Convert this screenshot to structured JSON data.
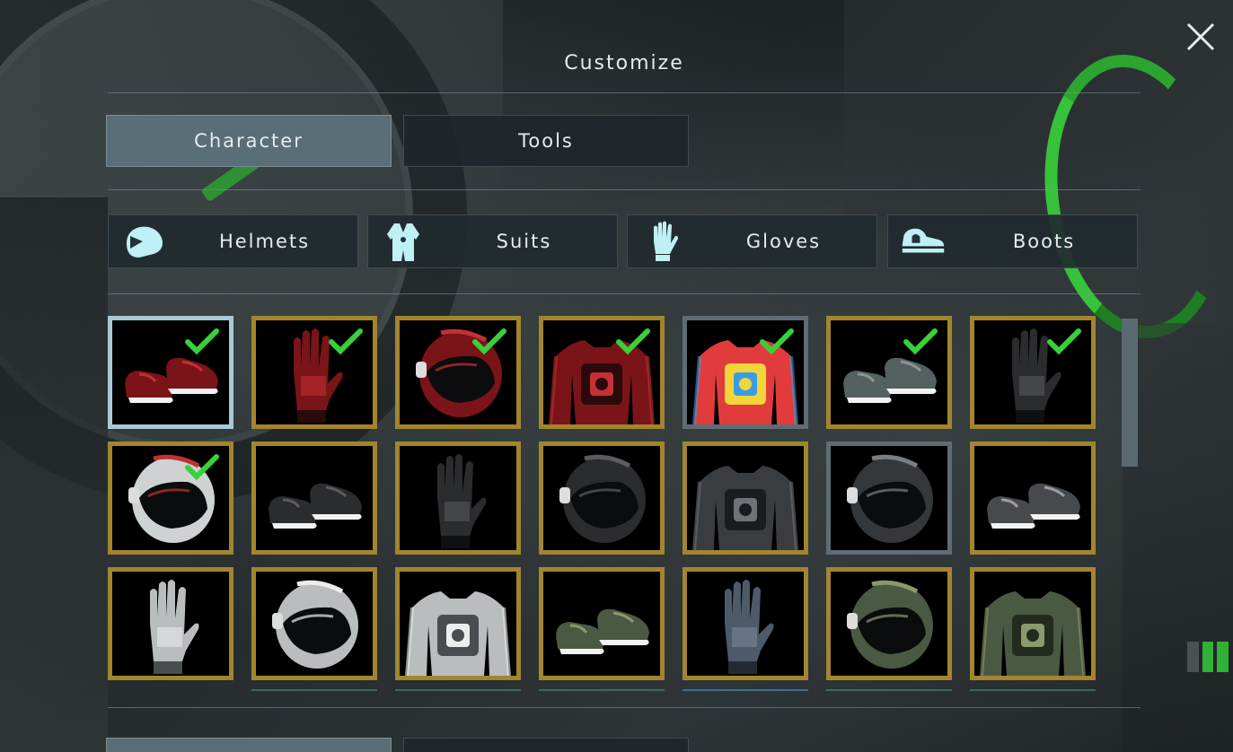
{
  "window": {
    "title": "Customize"
  },
  "tabs": [
    {
      "label": "Character",
      "active": true
    },
    {
      "label": "Tools",
      "active": false
    }
  ],
  "categories": [
    {
      "label": "Helmets",
      "icon": "helmet-icon"
    },
    {
      "label": "Suits",
      "icon": "suit-icon"
    },
    {
      "label": "Gloves",
      "icon": "glove-icon"
    },
    {
      "label": "Boots",
      "icon": "boot-icon"
    }
  ],
  "colors": {
    "accent_active_tab": "#5a6e77",
    "item_border_gold": "#a3852f",
    "item_border_selected": "#a9c9d8",
    "item_border_grey": "#5f6c73",
    "check_green": "#37d13a",
    "icon_cyan": "#bff0f5"
  },
  "items": [
    {
      "type": "boots",
      "variant": "red",
      "equipped": true,
      "selected": true
    },
    {
      "type": "gloves",
      "variant": "red",
      "equipped": true
    },
    {
      "type": "helmet",
      "variant": "red",
      "equipped": true
    },
    {
      "type": "suit",
      "variant": "red",
      "equipped": true
    },
    {
      "type": "suit",
      "variant": "rainbow",
      "equipped": true,
      "frame": "grey"
    },
    {
      "type": "boots",
      "variant": "camo-grey",
      "equipped": true
    },
    {
      "type": "gloves",
      "variant": "black",
      "equipped": true
    },
    {
      "type": "helmet",
      "variant": "white-red",
      "equipped": true
    },
    {
      "type": "boots",
      "variant": "black",
      "equipped": false
    },
    {
      "type": "gloves",
      "variant": "black",
      "equipped": false
    },
    {
      "type": "helmet",
      "variant": "black",
      "equipped": false
    },
    {
      "type": "suit",
      "variant": "dark-grey",
      "equipped": false
    },
    {
      "type": "helmet",
      "variant": "dark-metal",
      "equipped": false,
      "frame": "grey"
    },
    {
      "type": "boots",
      "variant": "grey",
      "equipped": false
    },
    {
      "type": "gloves",
      "variant": "white",
      "equipped": false
    },
    {
      "type": "helmet",
      "variant": "white",
      "equipped": false
    },
    {
      "type": "suit",
      "variant": "white",
      "equipped": false
    },
    {
      "type": "boots",
      "variant": "camo-green",
      "equipped": false
    },
    {
      "type": "gloves",
      "variant": "blue-grey",
      "equipped": false
    },
    {
      "type": "helmet",
      "variant": "camo-green",
      "equipped": false
    },
    {
      "type": "suit",
      "variant": "camo-green",
      "equipped": false
    }
  ]
}
